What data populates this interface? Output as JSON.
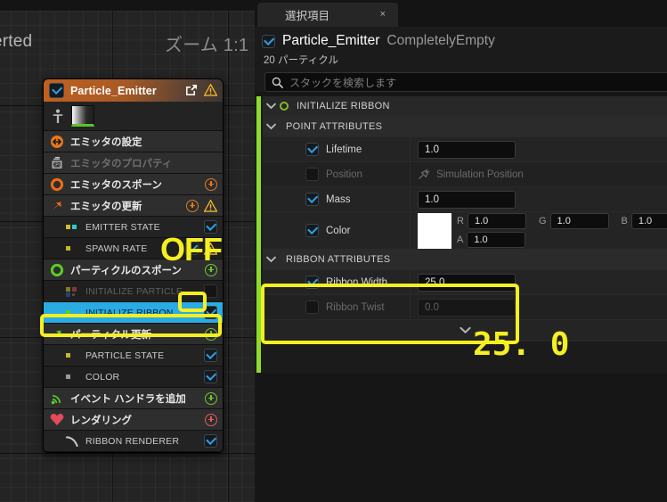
{
  "canvas": {
    "left_text": "erted",
    "zoom_label": "ズーム 1:1"
  },
  "emitter_node": {
    "title": "Particle_Emitter",
    "header_icons": [
      "open-in-new-icon",
      "warning-icon"
    ],
    "rows": [
      {
        "label": "エミッタの設定",
        "type": "module",
        "icon": "emitter-settings-icon",
        "right": []
      },
      {
        "label": "エミッタのプロパティ",
        "type": "module",
        "icon": "cpu-icon",
        "right": [],
        "dimmed": true
      },
      {
        "label": "エミッタのスポーン",
        "type": "module",
        "icon": "circle-orange-icon",
        "right": [
          "plus"
        ]
      },
      {
        "label": "エミッタの更新",
        "type": "module",
        "icon": "arrow-orange-icon",
        "right": [
          "plus",
          "warning"
        ]
      },
      {
        "label": "EMITTER STATE",
        "type": "sub",
        "icon": "dots-yellow-cyan-icon",
        "right": [
          "check-on"
        ]
      },
      {
        "label": "SPAWN RATE",
        "type": "sub",
        "icon": "dot-yellow-icon",
        "right": [
          "check-on",
          "warning"
        ]
      },
      {
        "label": "パーティクルのスポーン",
        "type": "module",
        "icon": "circle-green-icon",
        "right": [
          "plus-green"
        ]
      },
      {
        "label": "INITIALIZE PARTICLE",
        "type": "sub",
        "icon": "dots-multi-icon",
        "right": [
          "check-off"
        ],
        "dimmed": true
      },
      {
        "label": "INITIALIZE RIBBON",
        "type": "sub",
        "icon": "dot-green-icon",
        "right": [
          "check-on"
        ],
        "selected": true
      },
      {
        "label": "パーティクル更新",
        "type": "module",
        "icon": "arrow-green-icon",
        "right": [
          "plus-green"
        ]
      },
      {
        "label": "PARTICLE STATE",
        "type": "sub",
        "icon": "dot-yellow-icon",
        "right": [
          "check-on"
        ]
      },
      {
        "label": "COLOR",
        "type": "sub",
        "icon": "dot-gray-icon",
        "right": [
          "check-on"
        ]
      },
      {
        "label": "イベント ハンドラを追加",
        "type": "module",
        "icon": "event-handler-icon",
        "right": [
          "plus-green"
        ]
      },
      {
        "label": "レンダリング",
        "type": "module",
        "icon": "render-heart-icon",
        "right": [
          "plus-red"
        ]
      },
      {
        "label": "RIBBON RENDERER",
        "type": "sub",
        "icon": "ribbon-icon",
        "right": [
          "check-on"
        ]
      }
    ]
  },
  "right_panel": {
    "tab": {
      "label": "選択項目",
      "close": "×"
    },
    "selection": {
      "name": "Particle_Emitter",
      "qualifier": "CompletelyEmpty",
      "count_text": "20 パーティクル"
    },
    "search": {
      "placeholder": "スタックを検索します",
      "value": "",
      "icon": "search-icon"
    },
    "stack": {
      "module_header": "INITIALIZE RIBBON",
      "groups": [
        {
          "title": "POINT ATTRIBUTES",
          "attributes": [
            {
              "label": "Lifetime",
              "checked": true,
              "value": "1.0",
              "kind": "number"
            },
            {
              "label": "Position",
              "checked": false,
              "value": "Simulation Position",
              "kind": "link",
              "dimmed": true
            },
            {
              "label": "Mass",
              "checked": true,
              "value": "1.0",
              "kind": "number"
            },
            {
              "label": "Color",
              "checked": true,
              "kind": "color",
              "swatch": "#ffffff",
              "channels": [
                {
                  "name": "R",
                  "value": "1.0"
                },
                {
                  "name": "G",
                  "value": "1.0"
                },
                {
                  "name": "B",
                  "value": "1.0"
                },
                {
                  "name": "A",
                  "value": "1.0"
                }
              ]
            }
          ]
        },
        {
          "title": "RIBBON ATTRIBUTES",
          "highlighted": true,
          "attributes": [
            {
              "label": "Ribbon Width",
              "checked": true,
              "value": "25.0",
              "kind": "number"
            },
            {
              "label": "Ribbon Twist",
              "checked": false,
              "value": "0.0",
              "kind": "number",
              "dimmed": true
            }
          ]
        }
      ],
      "expander_icon": "chevron-down-icon"
    }
  },
  "annotations": {
    "off_label": "OFF",
    "value_label": "25. 0",
    "color": "#f5ef21",
    "boxes": [
      {
        "name": "initialize-particle-checkbox-highlight"
      },
      {
        "name": "initialize-ribbon-row-highlight"
      },
      {
        "name": "ribbon-attributes-highlight"
      }
    ]
  }
}
